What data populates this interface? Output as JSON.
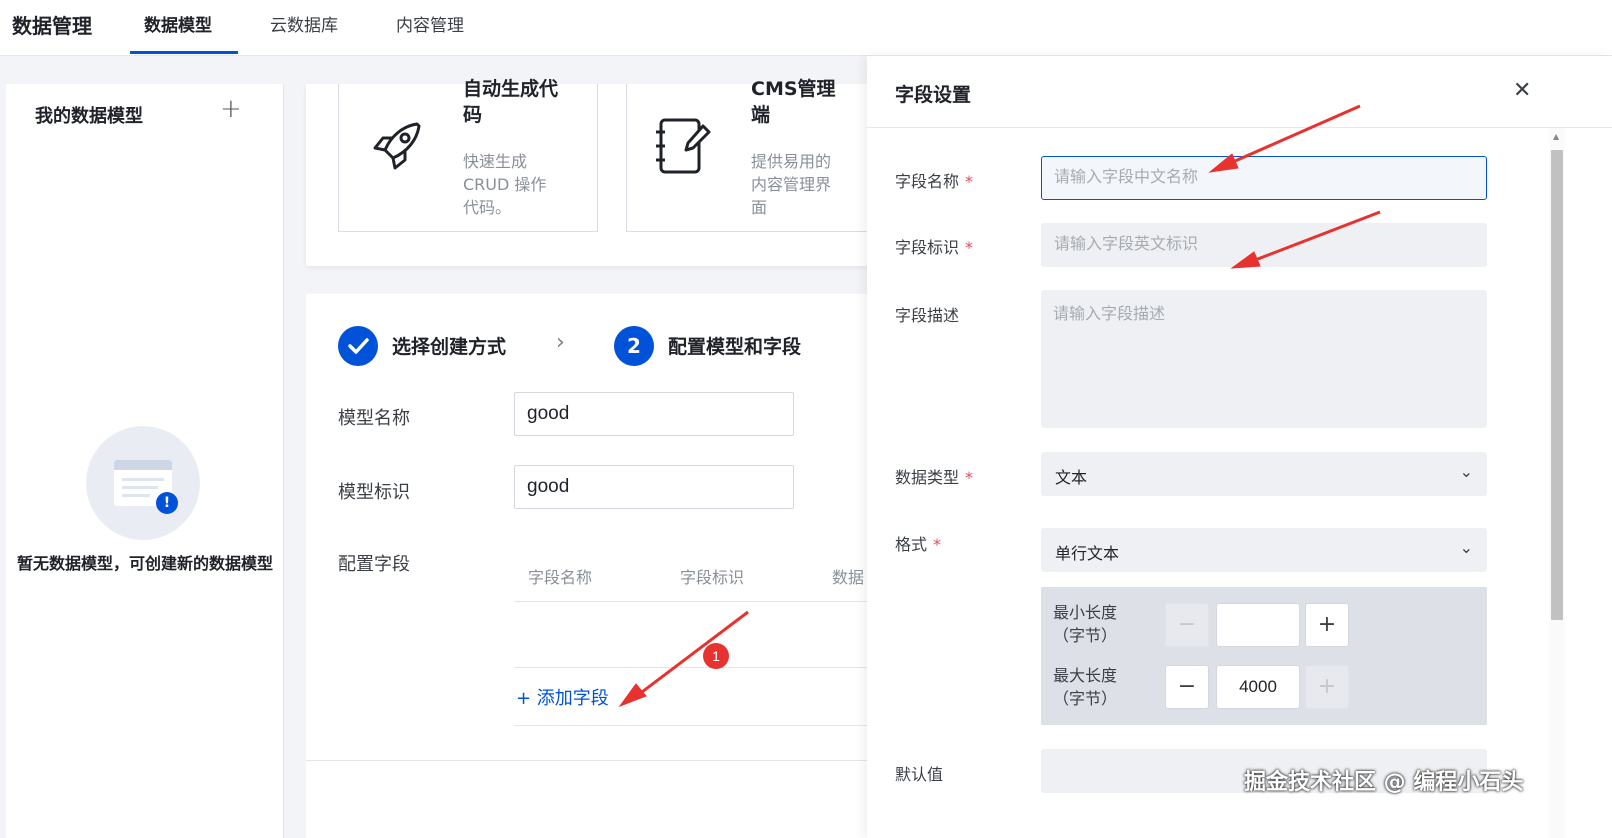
{
  "header": {
    "app_title": "数据管理",
    "tabs": [
      {
        "label": "数据模型",
        "active": true
      },
      {
        "label": "云数据库",
        "active": false
      },
      {
        "label": "内容管理",
        "active": false
      }
    ]
  },
  "sidebar": {
    "title": "我的数据模型",
    "add_icon": "plus-icon",
    "empty_text": "暂无数据模型，可创建新的数据模型"
  },
  "features": [
    {
      "title": "自动生成代码",
      "title_lines": [
        "自动生成代",
        "码"
      ],
      "desc_lines": [
        "快速生成",
        "CRUD 操作",
        "代码。"
      ],
      "icon": "rocket-icon"
    },
    {
      "title": "CMS管理端",
      "title_lines": [
        "CMS管理",
        "端"
      ],
      "desc_lines": [
        "提供易用的",
        "内容管理界",
        "面"
      ],
      "icon": "notebook-edit-icon"
    }
  ],
  "steps": [
    {
      "label": "选择创建方式",
      "status": "done"
    },
    {
      "number": "2",
      "label": "配置模型和字段",
      "status": "current"
    }
  ],
  "model_form": {
    "name_label": "模型名称",
    "name_value": "good",
    "id_label": "模型标识",
    "id_value": "good",
    "fields_label": "配置字段",
    "table_headers": [
      "字段名称",
      "字段标识",
      "数据"
    ],
    "add_field": "+ 添加字段"
  },
  "drawer": {
    "title": "字段设置",
    "close_icon": "close-icon",
    "field_name_label": "字段名称",
    "field_name_placeholder": "请输入字段中文名称",
    "field_id_label": "字段标识",
    "field_id_placeholder": "请输入字段英文标识",
    "field_desc_label": "字段描述",
    "field_desc_placeholder": "请输入字段描述",
    "data_type_label": "数据类型",
    "data_type_value": "文本",
    "format_label": "格式",
    "format_value": "单行文本",
    "min_length_label_1": "最小长度",
    "min_length_label_2": "（字节）",
    "min_length_value": "",
    "max_length_label_1": "最大长度",
    "max_length_label_2": "（字节）",
    "max_length_value": "4000",
    "default_label": "默认值",
    "required_mark": "*"
  },
  "annotations": {
    "badge_number": "1",
    "arrow_color": "#e8322f"
  },
  "watermark": "掘金技术社区 @ 编程小石头",
  "colors": {
    "brand": "#0052d9",
    "required": "#e34d59",
    "annotation": "#e8322f"
  }
}
